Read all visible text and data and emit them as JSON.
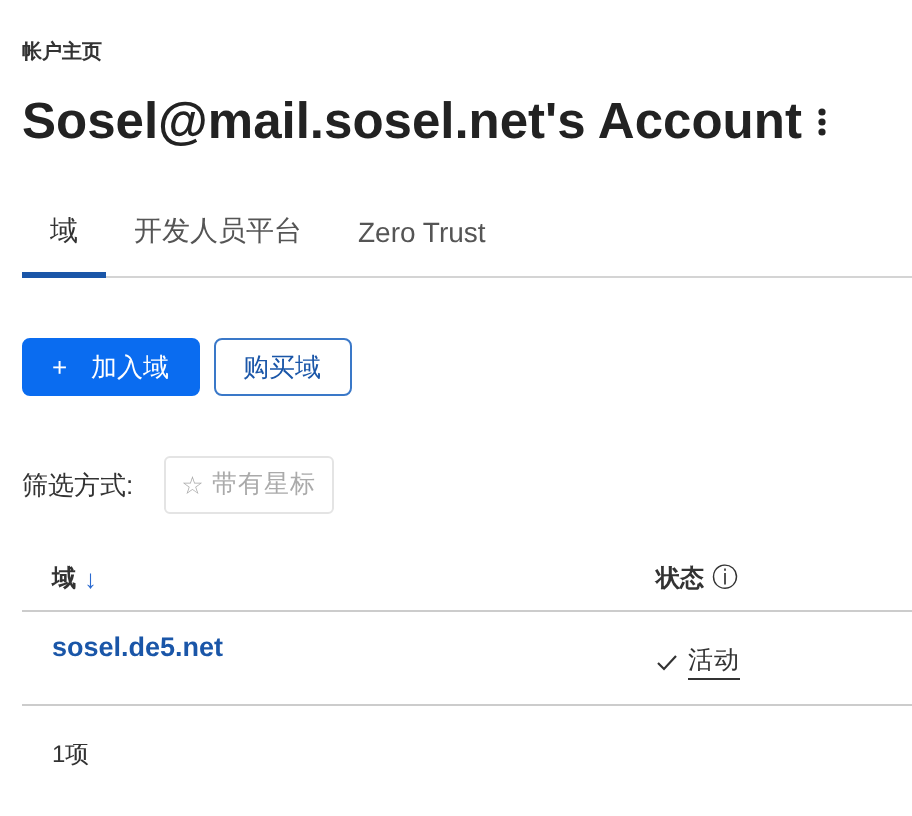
{
  "breadcrumb": "帐户主页",
  "title": "Sosel@mail.sosel.net's Account",
  "tabs": [
    {
      "label": "域",
      "selected": true
    },
    {
      "label": "开发人员平台",
      "selected": false
    },
    {
      "label": "Zero Trust",
      "selected": false
    }
  ],
  "actions": [
    {
      "kind": "primary",
      "icon": "+",
      "label": "加入域"
    },
    {
      "kind": "secondary",
      "label": "购买域"
    }
  ],
  "filter": {
    "label": "筛选方式:",
    "chip": {
      "icon": "☆",
      "label": "带有星标",
      "disabled": true
    }
  },
  "table": {
    "columns": [
      {
        "label": "域",
        "sort": "↓"
      },
      {
        "label": "状态",
        "info": "ⓘ"
      }
    ],
    "rows": [
      {
        "domain": "sosel.de5.net",
        "status": "活动",
        "active": true
      }
    ]
  },
  "footer": "1项"
}
